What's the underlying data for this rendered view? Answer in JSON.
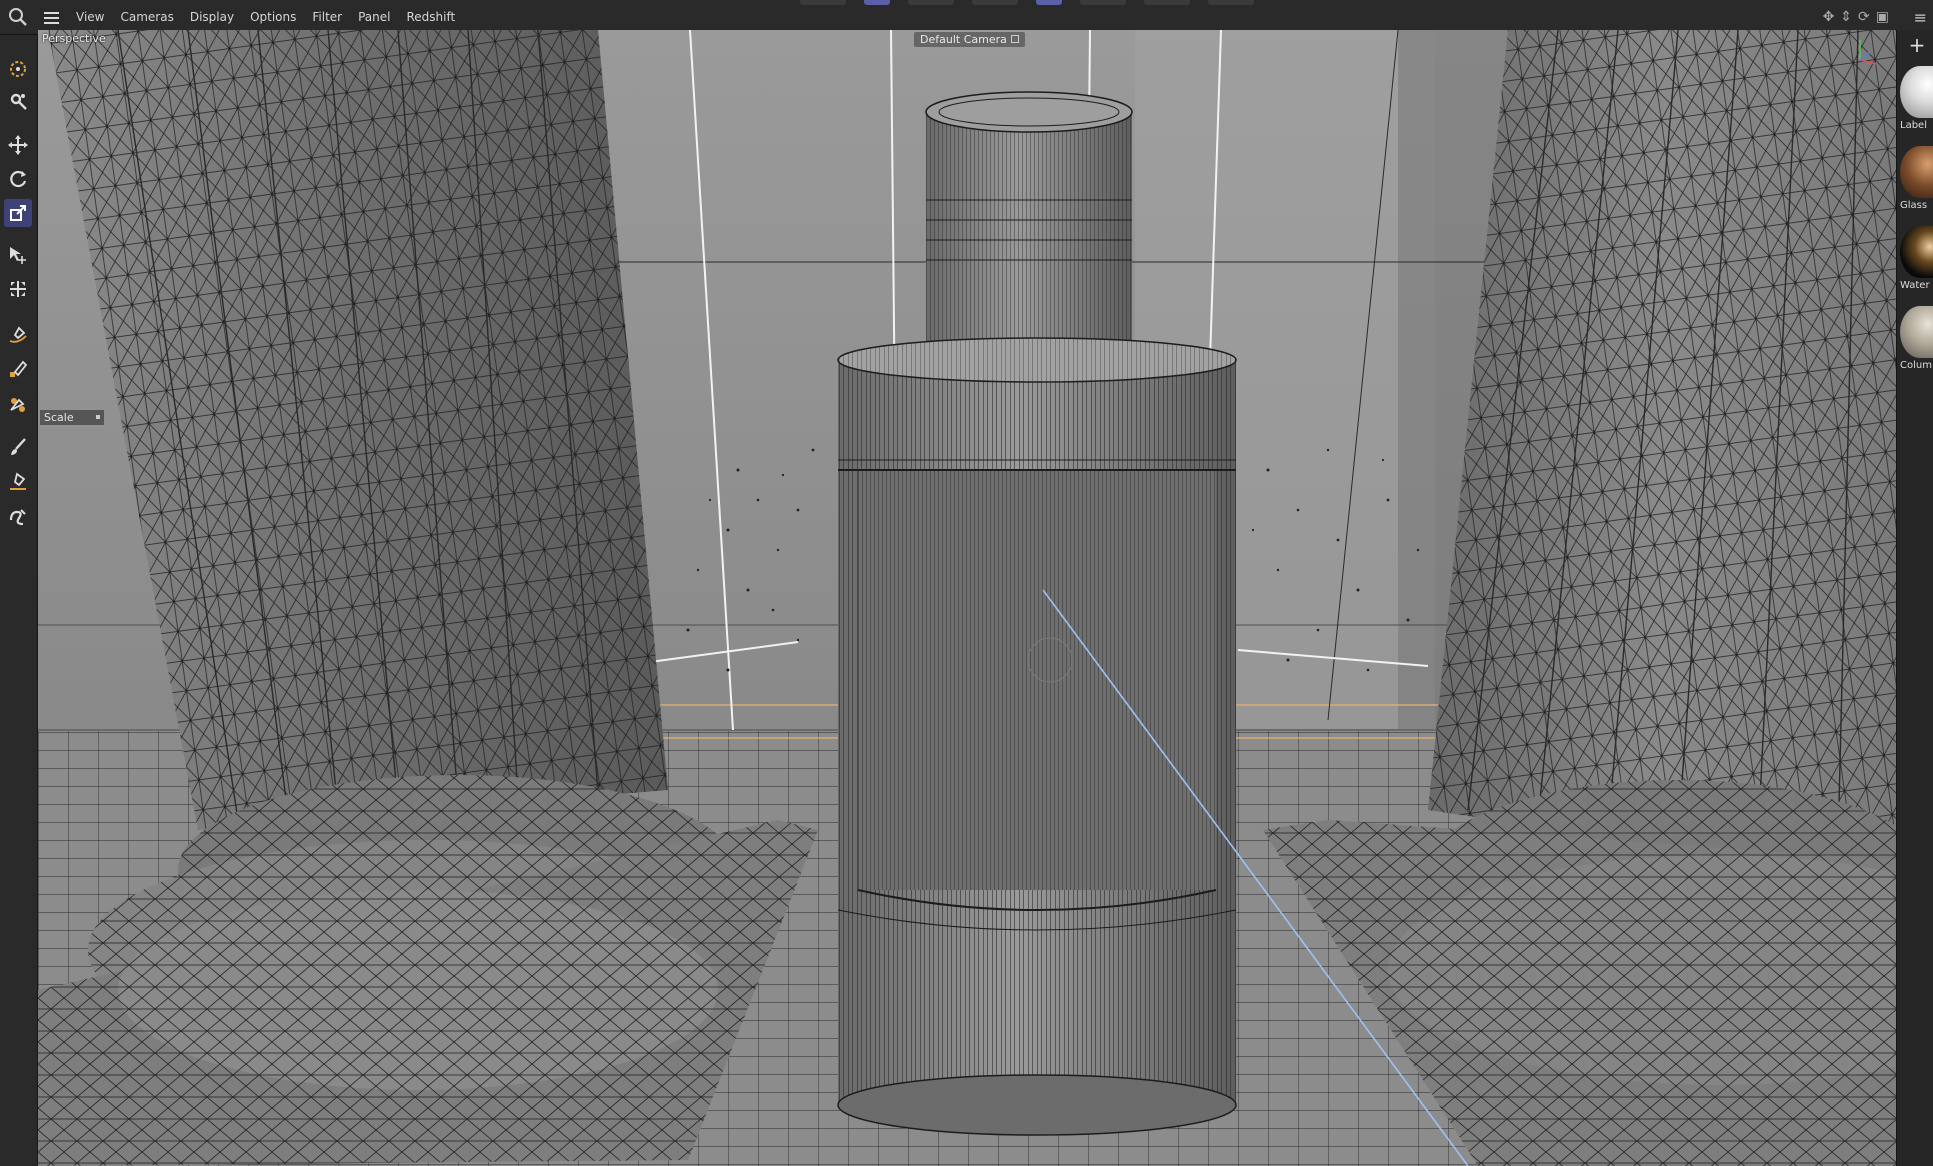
{
  "menubar": {
    "items": [
      "View",
      "Cameras",
      "Display",
      "Options",
      "Filter",
      "Panel",
      "Redshift"
    ],
    "search_icon": "search-icon",
    "menu_icon": "hamburger-icon"
  },
  "toolbar": {
    "tools": [
      {
        "name": "live-selection-icon",
        "active": false
      },
      {
        "name": "tools-settings-icon",
        "active": false
      },
      {
        "name": "move-icon",
        "active": false
      },
      {
        "name": "rotate-icon",
        "active": false
      },
      {
        "name": "scale-icon",
        "active": true
      },
      {
        "name": "select-move-icon",
        "active": false
      },
      {
        "name": "transform-icon",
        "active": false
      },
      {
        "name": "spline-pen-icon",
        "active": false
      },
      {
        "name": "spline-sketch-icon",
        "active": false
      },
      {
        "name": "spline-smooth-icon",
        "active": false
      },
      {
        "name": "brush-icon",
        "active": false
      },
      {
        "name": "polygon-pen-icon",
        "active": false
      },
      {
        "name": "smooth-shift-icon",
        "active": false
      }
    ]
  },
  "viewport": {
    "view_name": "Perspective",
    "camera_name": "Default Camera",
    "hud_tool_label": "Scale"
  },
  "materials": [
    {
      "name": "Label"
    },
    {
      "name": "Glass"
    },
    {
      "name": "Water"
    },
    {
      "name": "Colum"
    }
  ],
  "colors": {
    "accent": "#5a5fa8",
    "toolbar_bg": "#2a2a2a",
    "viewport_bg": "#8e8e8e",
    "wire": "#1a1a1a",
    "guide_orange": "#e6b26a",
    "guide_blue": "#9cc3f0"
  }
}
